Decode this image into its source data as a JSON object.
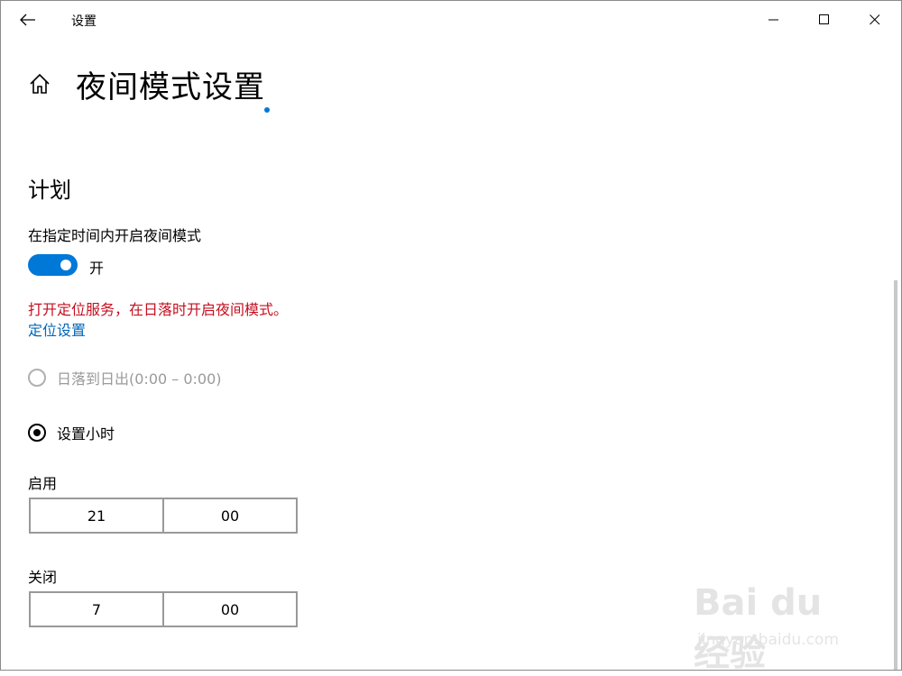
{
  "window": {
    "title": "设置"
  },
  "header": {
    "title": "夜间模式设置"
  },
  "schedule": {
    "section_title": "计划",
    "toggle_description": "在指定时间内开启夜间模式",
    "toggle_state": "开",
    "toggle_on": true,
    "warning": "打开定位服务，在日落时开启夜间模式。",
    "location_link": "定位设置",
    "radio_sunset_label": "日落到日出(0:00 – 0:00)",
    "radio_hours_label": "设置小时",
    "turn_on": {
      "label": "启用",
      "hour": "21",
      "minute": "00"
    },
    "turn_off": {
      "label": "关闭",
      "hour": "7",
      "minute": "00"
    }
  },
  "watermark": {
    "logo": "Bai du 经验",
    "url": "jingyan.baidu.com"
  },
  "colors": {
    "accent": "#0078d7",
    "warning": "#c50f1f",
    "link": "#0067b8"
  }
}
